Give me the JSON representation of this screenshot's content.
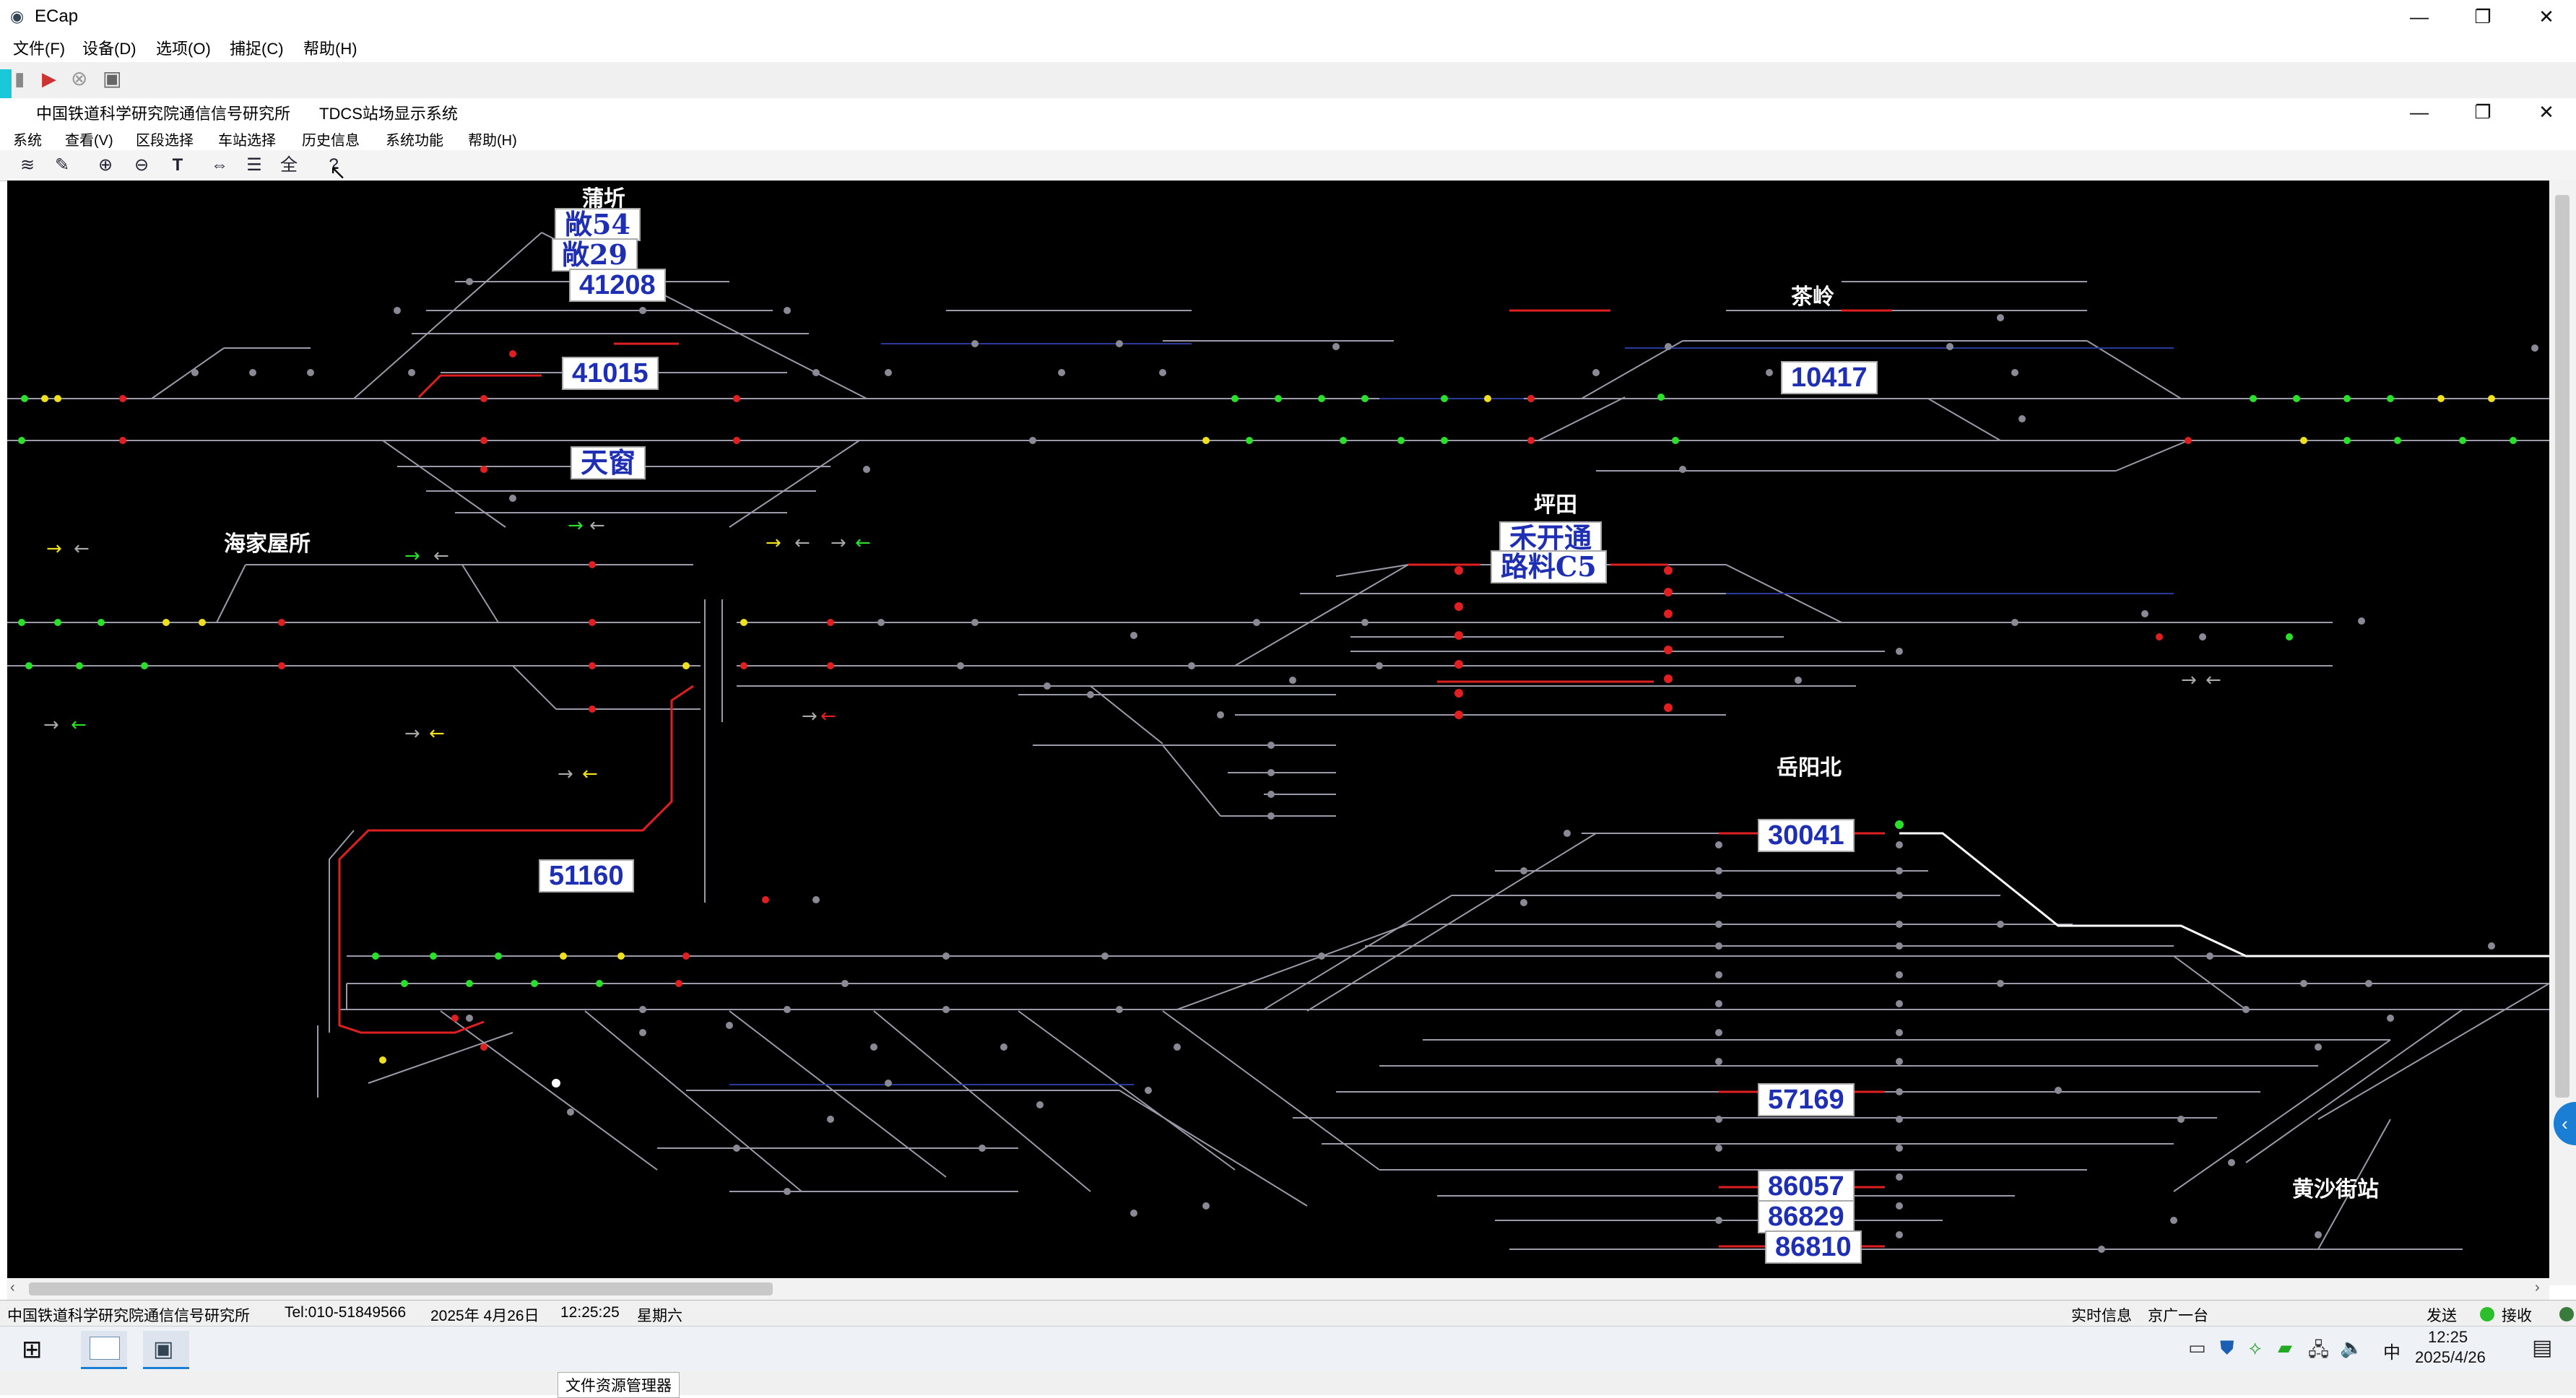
{
  "window": {
    "title": "ECap",
    "menu": [
      "文件(F)",
      "设备(D)",
      "选项(O)",
      "捕捉(C)",
      "帮助(H)"
    ],
    "minimize": "—",
    "restore": "❐",
    "close": "✕"
  },
  "inner_window": {
    "title_org": "中国铁道科学研究院通信信号研究所",
    "title_app": "TDCS站场显示系统",
    "menu": [
      "系统",
      "查看(V)",
      "区段选择",
      "车站选择",
      "历史信息",
      "系统功能",
      "帮助(H)"
    ],
    "toolbar_full_label": "全"
  },
  "diagram": {
    "stations": [
      "蒲圻",
      "茶岭",
      "海家屋所",
      "坪田",
      "岳阳北",
      "黄沙街站"
    ],
    "train_labels": [
      "敞54",
      "敞29",
      "41208",
      "41015",
      "天窗",
      "10417",
      "禾开通",
      "路料C5",
      "51160",
      "30041",
      "57169",
      "86057",
      "86829",
      "86810"
    ]
  },
  "statusbar": {
    "org": "中国铁道科学研究院通信信号研究所",
    "tel": "Tel:010-51849566",
    "date": "2025年 4月26日",
    "time": "12:25:25",
    "weekday": "星期六",
    "realtime": "实时信息",
    "line": "京广一台",
    "send": "发送",
    "receive": "接收"
  },
  "taskbar": {
    "clock_time": "12:25",
    "clock_date": "2025/4/26",
    "ime": "中",
    "explorer_label": "文件资源管理器"
  },
  "colors": {
    "route_red": "#e02020",
    "route_white": "#ffffff",
    "track_gray": "#9a9aa8",
    "track_blue": "#2a3a9a",
    "signal_green": "#2be02b",
    "signal_yellow": "#f0e020",
    "signal_red": "#e02020",
    "train_text_blue": "#1e2fb4"
  }
}
